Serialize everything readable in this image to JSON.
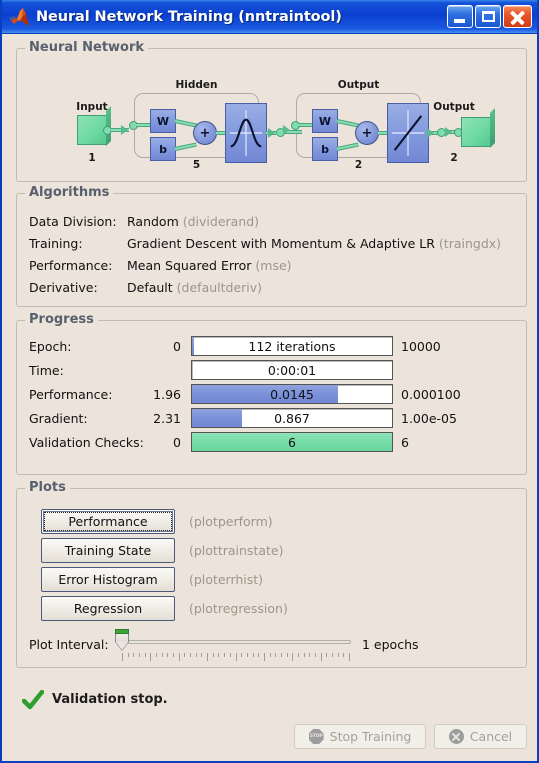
{
  "window": {
    "title": "Neural Network Training (nntraintool)",
    "icon": "matlab-membrane-icon",
    "minimize_label": "",
    "maximize_label": "",
    "close_label": ""
  },
  "neural_network": {
    "legend": "Neural Network",
    "input_label": "Input",
    "input_count": "1",
    "hidden_label": "Hidden",
    "hidden_count": "5",
    "output_layer_label": "Output",
    "output_layer_count": "2",
    "output_label": "Output",
    "output_count": "2",
    "weight_label": "W",
    "bias_label": "b",
    "sum_label": "+"
  },
  "algorithms": {
    "legend": "Algorithms",
    "rows": [
      {
        "key": "Data Division:",
        "value": "Random",
        "fn": "(dividerand)"
      },
      {
        "key": "Training:",
        "value": "Gradient Descent with Momentum & Adaptive LR",
        "fn": "(traingdx)"
      },
      {
        "key": "Performance:",
        "value": "Mean Squared Error",
        "fn": "(mse)"
      },
      {
        "key": "Derivative:",
        "value": "Default",
        "fn": "(defaultderiv)"
      }
    ]
  },
  "progress": {
    "legend": "Progress",
    "rows": [
      {
        "label": "Epoch:",
        "left": "0",
        "bar_text": "112 iterations",
        "right": "10000",
        "fill_pct": 1.1,
        "color": "blue"
      },
      {
        "label": "Time:",
        "left": "",
        "bar_text": "0:00:01",
        "right": "",
        "fill_pct": 0,
        "color": "blue"
      },
      {
        "label": "Performance:",
        "left": "1.96",
        "bar_text": "0.0145",
        "right": "0.000100",
        "fill_pct": 73,
        "color": "blue"
      },
      {
        "label": "Gradient:",
        "left": "2.31",
        "bar_text": "0.867",
        "right": "1.00e-05",
        "fill_pct": 25,
        "color": "blue"
      },
      {
        "label": "Validation Checks:",
        "left": "0",
        "bar_text": "6",
        "right": "6",
        "fill_pct": 100,
        "color": "green"
      }
    ]
  },
  "plots": {
    "legend": "Plots",
    "buttons": [
      {
        "label": "Performance",
        "fn": "(plotperform)",
        "focused": true
      },
      {
        "label": "Training State",
        "fn": "(plottrainstate)",
        "focused": false
      },
      {
        "label": "Error Histogram",
        "fn": "(ploterrhist)",
        "focused": false
      },
      {
        "label": "Regression",
        "fn": "(plotregression)",
        "focused": false
      }
    ],
    "plot_interval_label": "Plot Interval:",
    "plot_interval_value": "1 epochs",
    "slider_position_pct": 0
  },
  "status": {
    "icon": "green-check-icon",
    "message": "Validation stop."
  },
  "actions": {
    "stop_label": "Stop Training",
    "stop_icon": "stop-sign-icon",
    "stop_disabled": true,
    "cancel_label": "Cancel",
    "cancel_icon": "cancel-circle-icon",
    "cancel_disabled": true
  },
  "colors": {
    "background": "#ece4da",
    "titlebar": "#0a3fcf",
    "bar_blue": "#7b92d9",
    "bar_green": "#76dca8",
    "legend_text": "#57606e",
    "muted_text": "#9d968c"
  }
}
